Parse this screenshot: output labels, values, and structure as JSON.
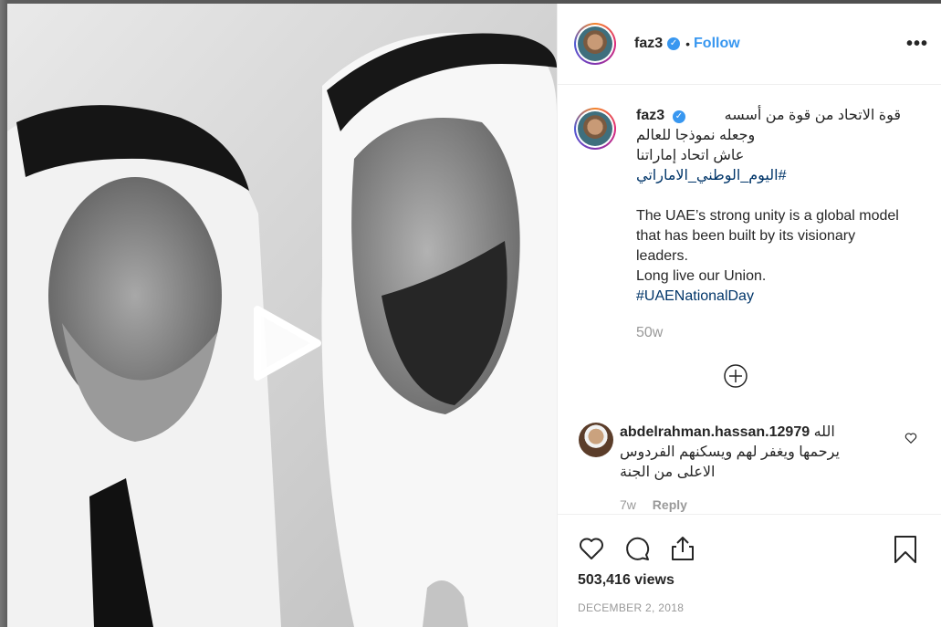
{
  "post": {
    "username": "faz3",
    "separator": "•",
    "follow_label": "Follow",
    "more_icon": "•••",
    "verified_icon": "✓"
  },
  "caption": {
    "username": "faz3",
    "arabic_line1": "قوة الاتحاد من قوة من أسسه",
    "arabic_line2": "وجعله نموذجا للعالم",
    "arabic_line3": "عاش اتحاد إماراتنا",
    "arabic_hashtag": "#اليوم_الوطني_الاماراتي",
    "english_line1": "The UAE’s strong unity is a global model that has been built by its visionary leaders.",
    "english_line2": "Long live our Union.",
    "english_hashtag": "#UAENationalDay",
    "time": "50w"
  },
  "comment": {
    "username": "abdelrahman.hassan.12979",
    "text_line1": "الله",
    "text_line2": "يرحمها ويغفر لهم ويسكنهم الفردوس الاعلى من الجنة",
    "time": "7w",
    "reply_label": "Reply"
  },
  "stats": {
    "views": "503,416 views",
    "date": "DECEMBER 2, 2018"
  },
  "icons": {
    "heart": "heart-icon",
    "comment": "comment-icon",
    "share": "share-icon",
    "save": "bookmark-icon",
    "play": "play-icon",
    "load_more": "plus-circle-icon"
  }
}
